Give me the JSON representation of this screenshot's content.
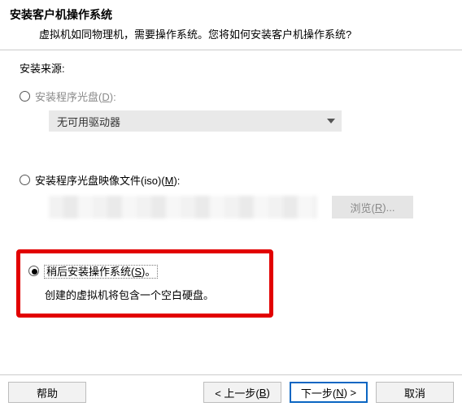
{
  "header": {
    "title": "安装客户机操作系统",
    "subtitle": "虚拟机如同物理机，需要操作系统。您将如何安装客户机操作系统?"
  },
  "source_label": "安装来源:",
  "opt_disc": {
    "label_pre": "安装程序光盘(",
    "mnemonic": "D",
    "label_post": "):",
    "combo_text": "无可用驱动器"
  },
  "opt_iso": {
    "label_pre": "安装程序光盘映像文件(iso)(",
    "mnemonic": "M",
    "label_post": "):",
    "browse_pre": "浏览(",
    "browse_mn": "R",
    "browse_post": ")..."
  },
  "opt_later": {
    "label_pre": "稍后安装操作系统(",
    "mnemonic": "S",
    "label_post": ")。",
    "sub": "创建的虚拟机将包含一个空白硬盘。"
  },
  "footer": {
    "help": "帮助",
    "back_pre": "< 上一步(",
    "back_mn": "B",
    "back_post": ")",
    "next_pre": "下一步(",
    "next_mn": "N",
    "next_post": ") >",
    "cancel": "取消"
  }
}
